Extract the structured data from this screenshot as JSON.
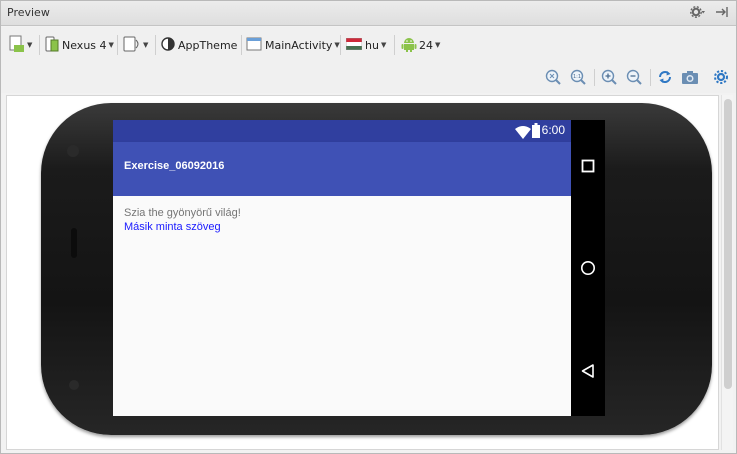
{
  "panel": {
    "title": "Preview",
    "icons": [
      "gear-icon",
      "hide-icon"
    ]
  },
  "toolbar": {
    "device": "Nexus 4",
    "theme": "AppTheme",
    "activity": "MainActivity",
    "locale": "hu",
    "api": "24"
  },
  "zoom": {
    "icons": [
      "zoom-fit-icon",
      "zoom-actual-icon",
      "zoom-in-icon",
      "zoom-out-icon",
      "refresh-icon",
      "screenshot-icon",
      "settings-icon"
    ]
  },
  "device_screen": {
    "status_time": "6:00",
    "app_title": "Exercise_06092016",
    "text_primary": "Szia the gyönyörű világ!",
    "text_secondary": "Másik minta szöveg"
  },
  "colors": {
    "status_bar": "#303f9f",
    "app_bar": "#3f51b5",
    "link_text": "#1a1aff",
    "android_green": "#8bc34a"
  }
}
